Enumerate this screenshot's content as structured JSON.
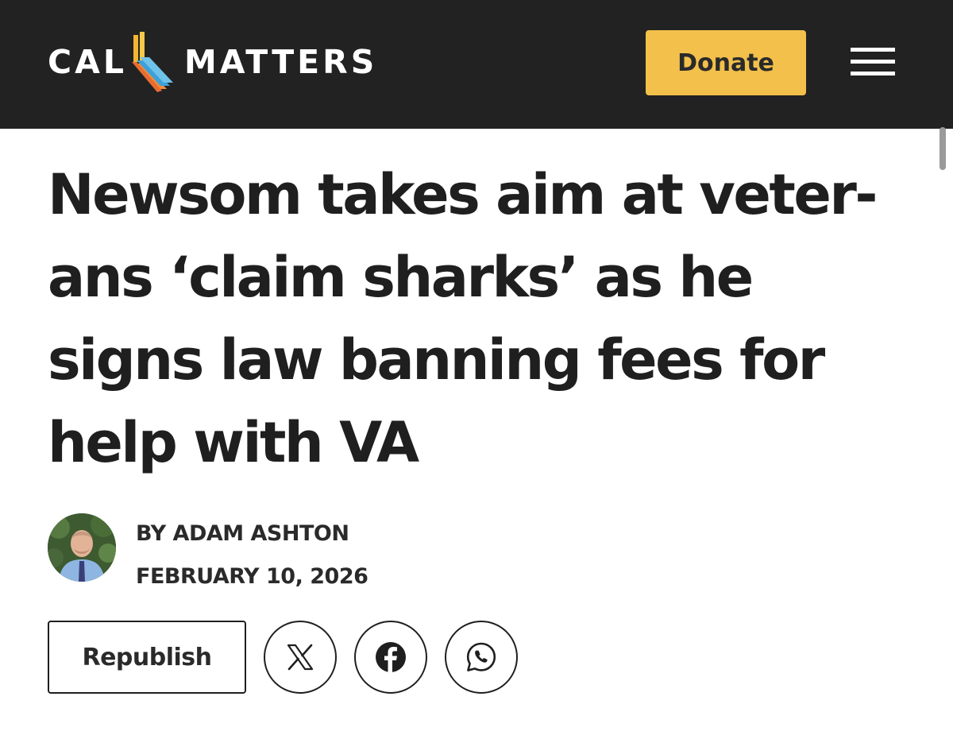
{
  "header": {
    "logo": {
      "left_text": "CAL",
      "right_text": "MATTERS",
      "icon": "california-state-logo-icon"
    },
    "donate_label": "Donate",
    "menu_icon": "hamburger-menu-icon"
  },
  "article": {
    "headline_lines": [
      "Newsom takes aim at veter-",
      "ans ‘claim sharks’ as he",
      "signs law banning fees for",
      "help with VA"
    ],
    "byline": "BY ADAM ASHTON",
    "date": "FEBRUARY 10, 2026"
  },
  "actions": {
    "republish_label": "Republish",
    "share_icons": [
      "x-logo-icon",
      "facebook-icon",
      "whatsapp-icon"
    ]
  },
  "colors": {
    "header_bg": "#222222",
    "donate_bg": "#f2c04b",
    "logo_stripes": [
      "#f2b632",
      "#f28c3a",
      "#3ea0d8",
      "#6fc2e8"
    ]
  }
}
